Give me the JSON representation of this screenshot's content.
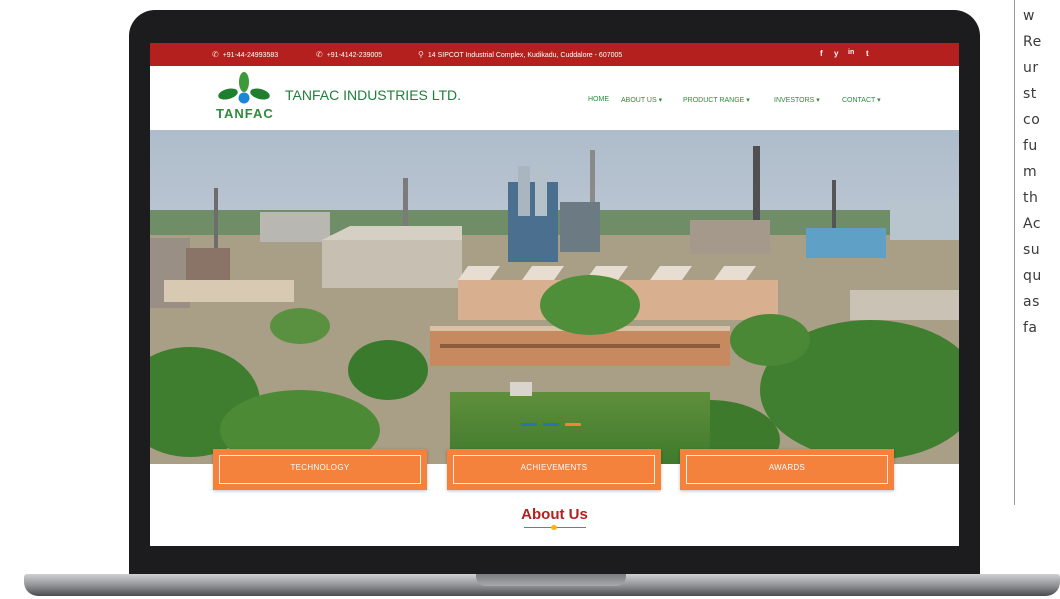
{
  "side_text": [
    "w",
    "Re",
    "ur",
    "st",
    "co",
    "fu",
    "m",
    "th",
    "Ac",
    "su",
    "qu",
    "as",
    "fa"
  ],
  "topbar": {
    "phone1": "+91-44-24993583",
    "phone2": "+91-4142-239005",
    "address": "14 SIPCOT Industrial Complex, Kudikadu, Cuddalore - 607005",
    "social": [
      "f",
      "y",
      "in",
      "t"
    ]
  },
  "header": {
    "logo_text": "TANFAC",
    "company_name": "TANFAC INDUSTRIES LTD.",
    "nav": [
      "HOME",
      "ABOUT US ▾",
      "PRODUCT RANGE ▾",
      "INVESTORS ▾",
      "CONTACT ▾"
    ]
  },
  "tiles": [
    "TECHNOLOGY",
    "ACHIEVEMENTS",
    "AWARDS"
  ],
  "about": {
    "title": "About Us"
  },
  "colors": {
    "topbar": "#b3201d",
    "tile": "#f4813c",
    "brand_green": "#2f8a3c",
    "heading_red": "#b3201d"
  }
}
